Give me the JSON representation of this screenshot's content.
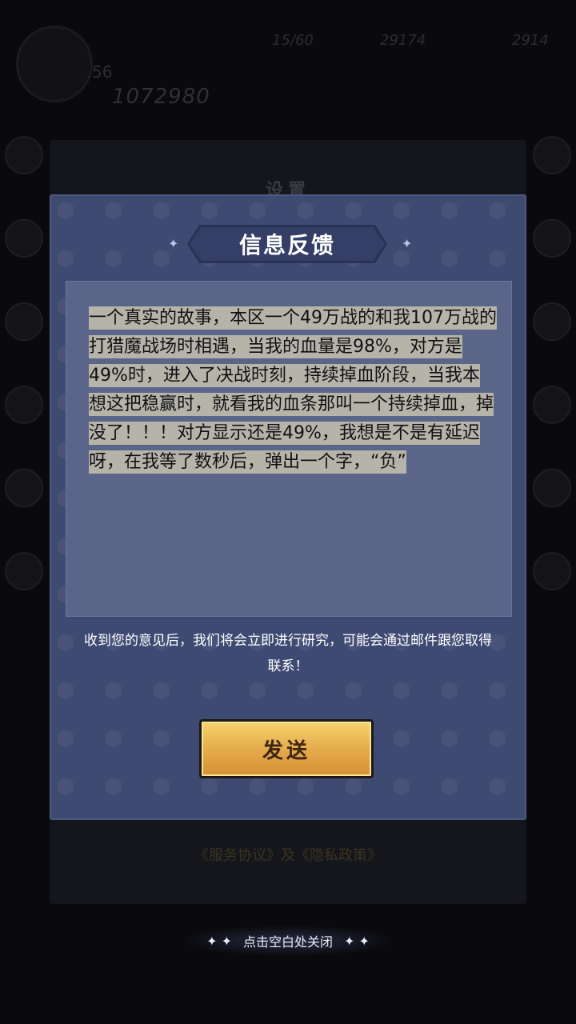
{
  "hud": {
    "level": "56",
    "power": "1072980",
    "name": "",
    "resources": [
      "15/60",
      "29174",
      "2914"
    ]
  },
  "settings": {
    "title": "设置",
    "links": "《服务协议》及《隐私政策》"
  },
  "dialog": {
    "title": "信息反馈",
    "feedback_text": "一个真实的故事，本区一个49万战的和我107万战的打猎魔战场时相遇，当我的血量是98%，对方是49%时，进入了决战时刻，持续掉血阶段，当我本想这把稳赢时，就看我的血条那叫一个持续掉血，掉没了！！！对方显示还是49%，我想是不是有延迟呀，在我等了数秒后，弹出一个字，“负”",
    "notice": "收到您的意见后，我们将会立即进行研究，可能会通过邮件跟您取得联系！",
    "send_label": "发送"
  },
  "close_hint": "点击空白处关闭",
  "colors": {
    "dialog_bg": "#3f4a72",
    "button": "#e9b24f",
    "text_highlight": "#b6b4a8"
  }
}
